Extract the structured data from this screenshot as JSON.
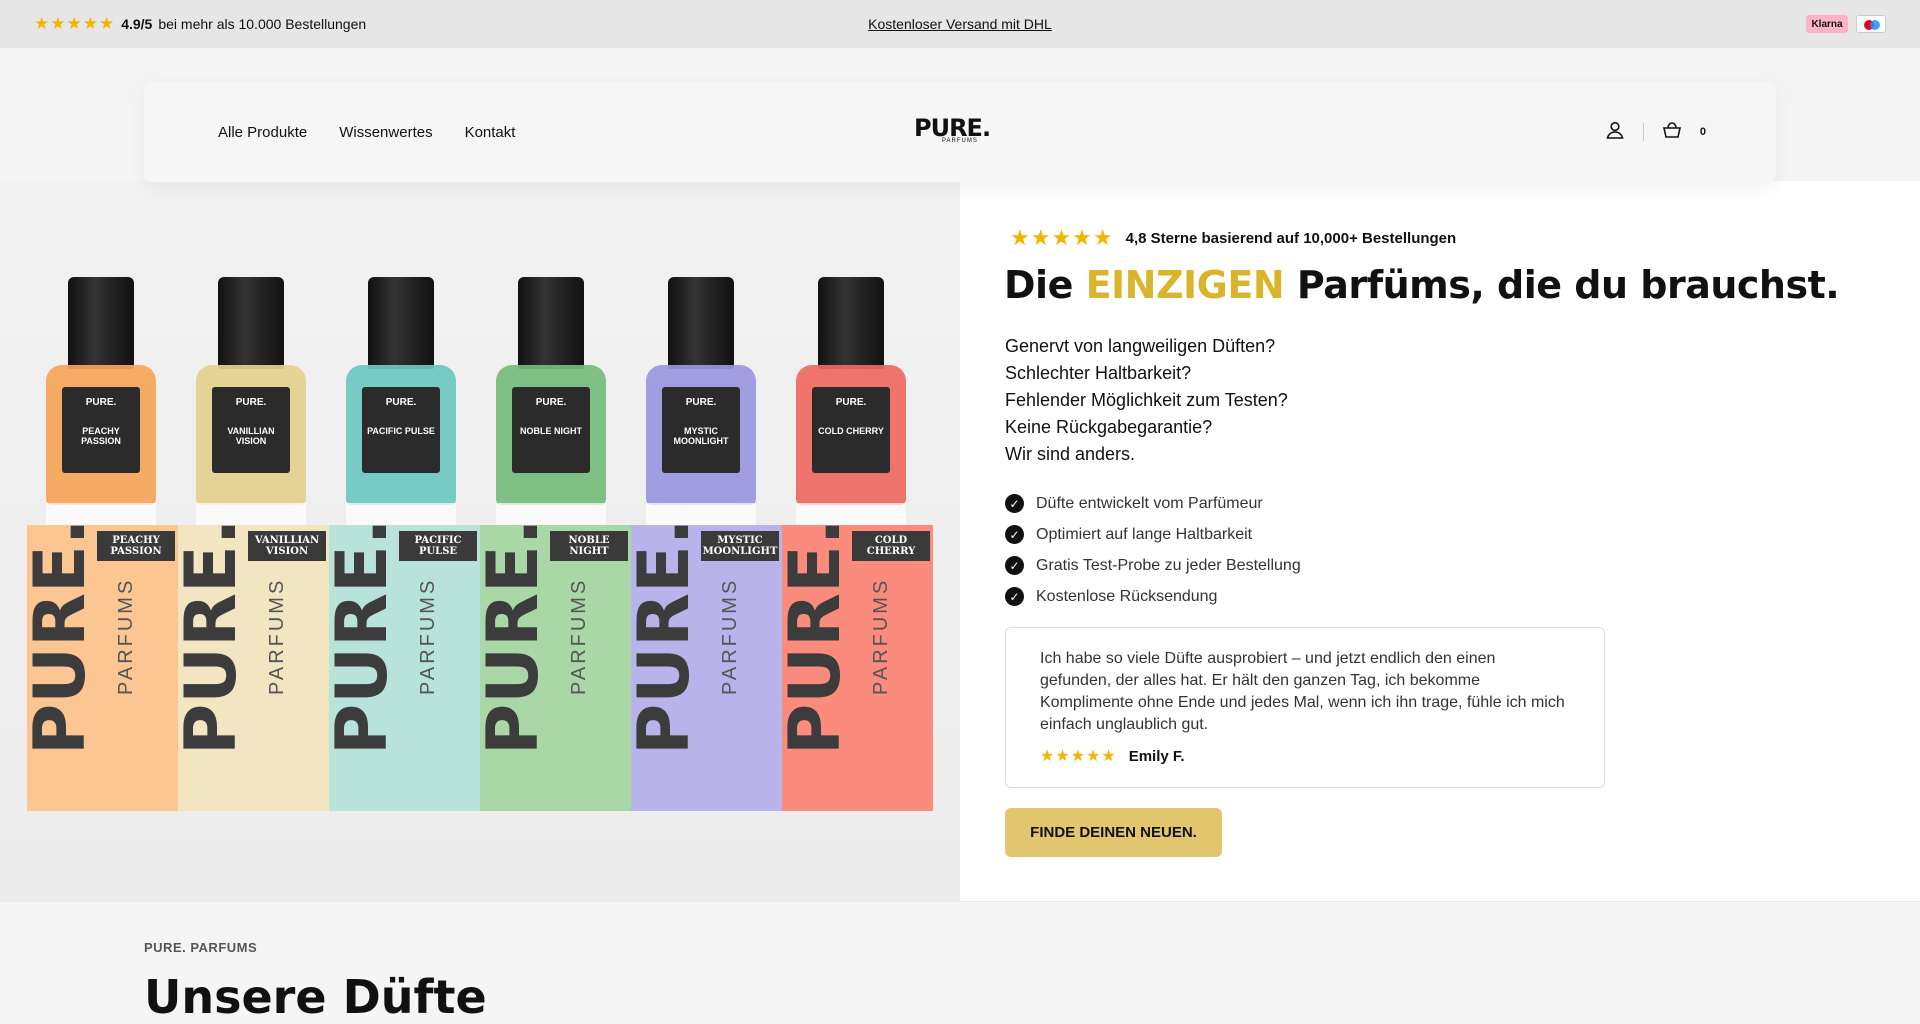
{
  "topbar": {
    "stars": "★★★★★",
    "rating_value": "4.9/5",
    "rating_text": "bei mehr als 10.000 Bestellungen",
    "shipping": "Kostenloser Versand mit DHL",
    "payment_klarna": "Klarna"
  },
  "header": {
    "nav": [
      "Alle Produkte",
      "Wissenwertes",
      "Kontakt"
    ],
    "logo_text": "PURE.",
    "logo_sub": "PARFUMS",
    "cart_count": "0"
  },
  "products": [
    {
      "name": "PEACHY PASSION",
      "line1": "PEACHY",
      "line2": "PASSION",
      "color": "#f7a65a",
      "box": "#fbc692"
    },
    {
      "name": "VANILLIAN VISION",
      "line1": "VANILLIAN",
      "line2": "VISION",
      "color": "#e5d08e",
      "box": "#f2e6c2"
    },
    {
      "name": "PACIFIC PULSE",
      "line1": "PACIFIC",
      "line2": "PULSE",
      "color": "#6cc8bf",
      "box": "#b7e3da"
    },
    {
      "name": "NOBLE NIGHT",
      "line1": "NOBLE",
      "line2": "NIGHT",
      "color": "#75bd7c",
      "box": "#a9d8a6"
    },
    {
      "name": "MYSTIC MOONLIGHT",
      "line1": "MYSTIC",
      "line2": "MOONLIGHT",
      "color": "#9a98e0",
      "box": "#b8b3ea"
    },
    {
      "name": "COLD CHERRY",
      "line1": "COLD",
      "line2": "CHERRY",
      "color": "#ee6a60",
      "box": "#fb8c7d"
    }
  ],
  "hero": {
    "rating_stars": "★★★★★",
    "rating_text": "4,8 Sterne basierend auf 10,000+ Bestellungen",
    "headline_pre": "Die",
    "headline_highlight": "EINZIGEN",
    "headline_post": "Parfüms, die du brauchst.",
    "intro": [
      "Genervt von langweiligen Düften?",
      "Schlechter Haltbarkeit?",
      "Fehlender Möglichkeit zum Testen?",
      "Keine Rückgabegarantie?",
      "Wir sind anders."
    ],
    "bullets": [
      "Düfte entwickelt vom Parfümeur",
      "Optimiert auf lange Haltbarkeit",
      "Gratis Test-Probe zu jeder Bestellung",
      "Kostenlose Rücksendung"
    ],
    "review_text": "Ich habe so viele Düfte ausprobiert – und jetzt endlich den einen gefunden, der alles hat. Er hält den ganzen Tag, ich bekomme Komplimente ohne Ende und jedes Mal, wenn ich ihn trage, fühle ich mich einfach unglaublich gut.",
    "review_stars": "★★★★★",
    "review_author": "Emily F.",
    "cta": "FINDE DEINEN NEUEN."
  },
  "lower": {
    "eyebrow": "PURE. PARFUMS",
    "heading": "Unsere Düfte"
  },
  "colors": {
    "accent": "#d9b52b",
    "cta": "#e2c66e",
    "star": "#f4b400"
  }
}
